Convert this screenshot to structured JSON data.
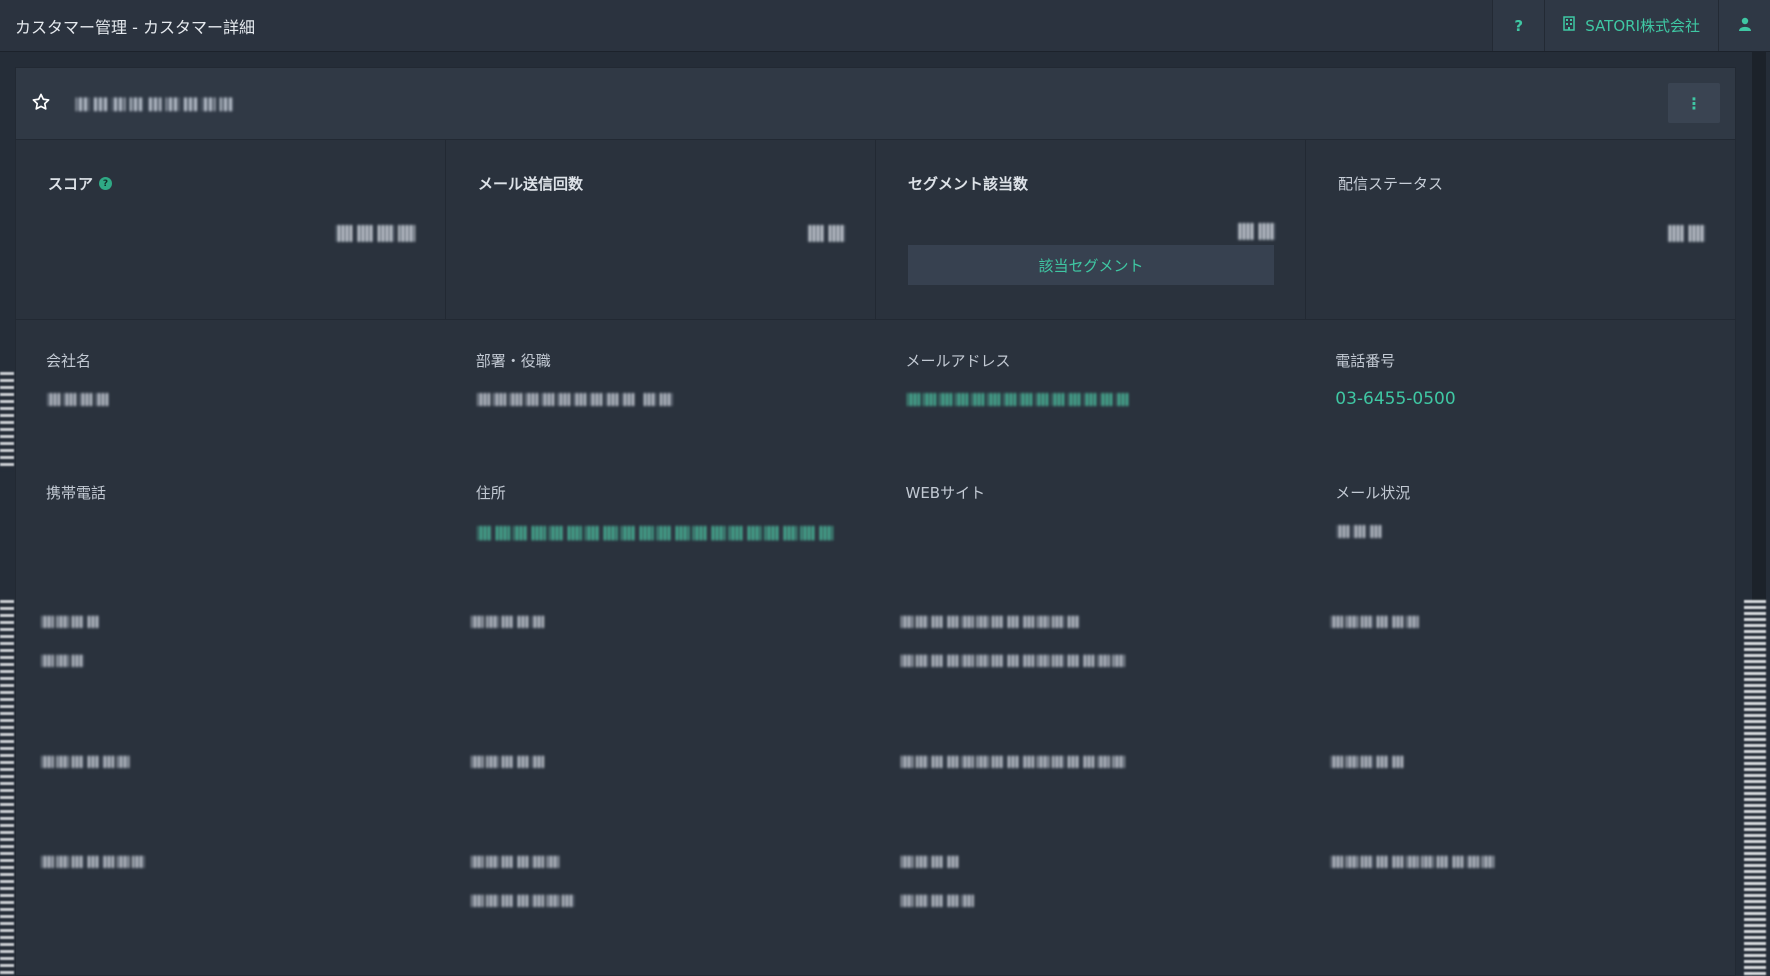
{
  "topbar": {
    "title": "カスタマー管理 - カスタマー詳細",
    "help_label": "?",
    "company_name": "SATORI株式会社",
    "company_icon": "building-icon",
    "user_icon": "user-icon"
  },
  "header": {
    "star_icon": "star-outline-icon",
    "customer_name": "■■■■■■■■■",
    "menu_icon": "vertical-dots-icon",
    "menu_label": "⋮"
  },
  "stats": [
    {
      "label": "スコア",
      "value": "■■■■"
    },
    {
      "label": "メール送信回数",
      "value": "■■"
    },
    {
      "label": "セグメント該当数",
      "value": "■■",
      "button": "該当セグメント"
    },
    {
      "label": "配信ステータス",
      "value": "■■"
    }
  ],
  "fields": [
    {
      "label": "会社名",
      "value": "■■■■"
    },
    {
      "label": "部署・役職",
      "value": "■■■■■■■■■■ ■■"
    },
    {
      "label": "メールアドレス",
      "value": "■■■■■■■■■■■■■■"
    },
    {
      "label": "電話番号",
      "value": "03-6455-0500"
    },
    {
      "label": "携帯電話",
      "value": ""
    },
    {
      "label": "住所",
      "value": "■■■■■■■■■■■■■■■■■■■■"
    },
    {
      "label": "WEBサイト",
      "value": ""
    },
    {
      "label": "メール状況",
      "value": "■■■"
    }
  ],
  "redacted_rows": [
    {
      "cells": [
        [
          "■■■■",
          "■■■"
        ],
        [
          "■■■■■"
        ],
        [
          "■■■■■■■■■■■■",
          "■■■■■■■■■■■■■■■"
        ],
        [
          "■■■■■■"
        ]
      ]
    },
    {
      "cells": [
        [
          "■■■■■■"
        ],
        [
          "■■■■■"
        ],
        [
          "■■■■■■■■■■■■■■■"
        ],
        [
          "■■■■■"
        ]
      ]
    },
    {
      "cells": [
        [
          "■■■■■■■"
        ],
        [
          "■■■■■■",
          "■■■■■■■"
        ],
        [
          "■■■■",
          "■■■■■"
        ],
        [
          "■■■■■■■■■■■"
        ]
      ]
    }
  ],
  "colors": {
    "accent": "#3fc7a3",
    "background": "#252d38",
    "card": "#2a323d"
  }
}
